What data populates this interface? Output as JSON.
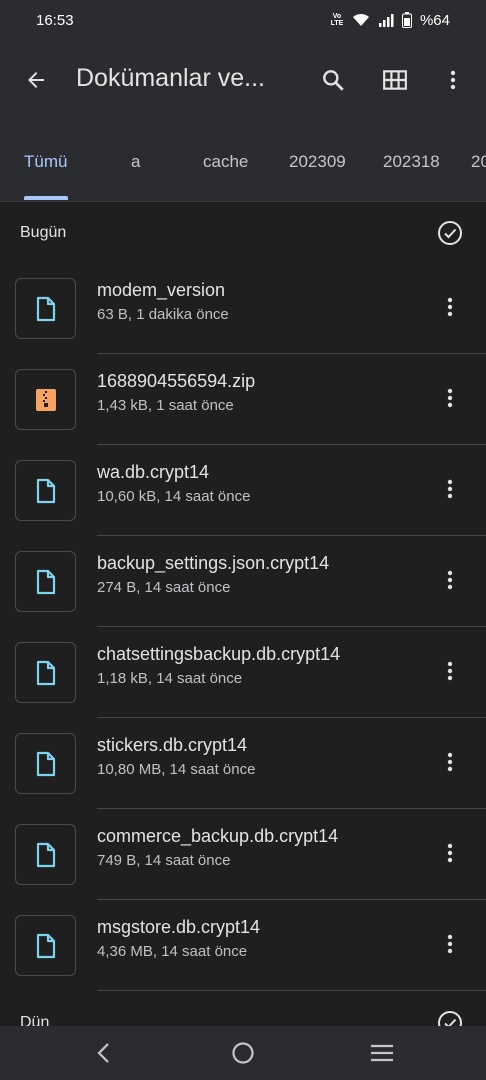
{
  "status_bar": {
    "time": "16:53",
    "volte_label": "Vo)) LTE",
    "battery": "%64",
    "icons": [
      "volte-icon",
      "wifi-icon",
      "signal-icon",
      "battery-icon"
    ]
  },
  "app_bar": {
    "title": "Dokümanlar ve...",
    "icons": [
      "back-arrow-icon",
      "search-icon",
      "grid-view-icon",
      "more-vert-icon"
    ]
  },
  "tabs": [
    {
      "label": "Tümü",
      "active": true
    },
    {
      "label": "a",
      "active": false
    },
    {
      "label": "cache",
      "active": false
    },
    {
      "label": "202309",
      "active": false
    },
    {
      "label": "202318",
      "active": false
    },
    {
      "label": "20",
      "active": false
    }
  ],
  "sections": [
    {
      "label": "Bugün"
    },
    {
      "label": "Dün"
    }
  ],
  "files": [
    {
      "name": "modem_version",
      "meta": "63 B, 1 dakika önce",
      "type": "document"
    },
    {
      "name": "1688904556594.zip",
      "meta": "1,43 kB, 1 saat önce",
      "type": "zip"
    },
    {
      "name": "wa.db.crypt14",
      "meta": "10,60 kB, 14 saat önce",
      "type": "document"
    },
    {
      "name": "backup_settings.json.crypt14",
      "meta": "274 B, 14 saat önce",
      "type": "document"
    },
    {
      "name": "chatsettingsbackup.db.crypt14",
      "meta": "1,18 kB, 14 saat önce",
      "type": "document"
    },
    {
      "name": "stickers.db.crypt14",
      "meta": "10,80 MB, 14 saat önce",
      "type": "document"
    },
    {
      "name": "commerce_backup.db.crypt14",
      "meta": "749 B, 14 saat önce",
      "type": "document"
    },
    {
      "name": "msgstore.db.crypt14",
      "meta": "4,36 MB, 14 saat önce",
      "type": "document"
    }
  ],
  "colors": {
    "background": "#1f1f1f",
    "surface": "#2b2c30",
    "accent": "#a8c7fa",
    "doc_icon": "#7fd3ee",
    "zip_icon": "#f7a25f"
  },
  "nav_bar": {
    "icons": [
      "nav-back-icon",
      "nav-home-icon",
      "nav-recents-icon"
    ]
  }
}
